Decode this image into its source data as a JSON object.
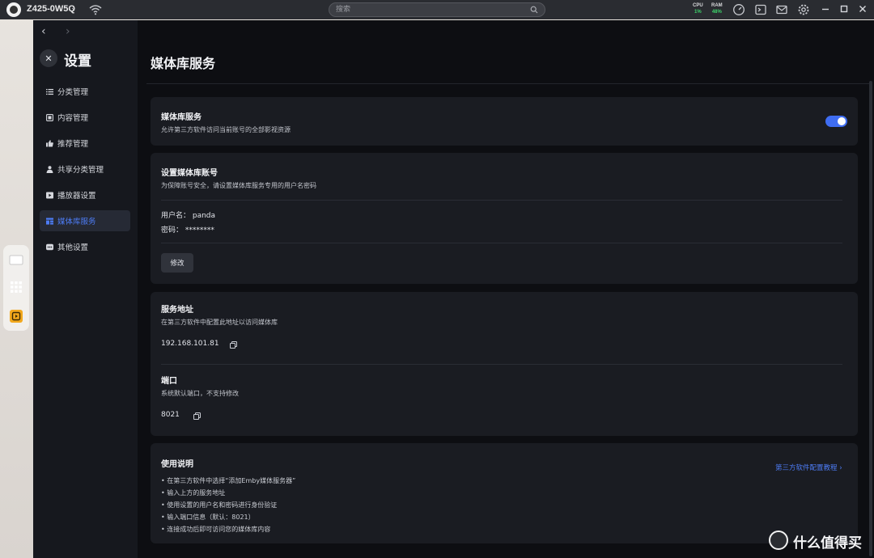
{
  "topbar": {
    "device_name": "Z425-0W5Q",
    "search_placeholder": "搜索",
    "cpu_label": "CPU",
    "cpu_value": "1%",
    "ram_label": "RAM",
    "ram_value": "48%"
  },
  "sidebar": {
    "title": "设置",
    "items": [
      {
        "label": "分类管理",
        "icon": "list-icon"
      },
      {
        "label": "内容管理",
        "icon": "content-icon"
      },
      {
        "label": "推荐管理",
        "icon": "thumb-up-icon"
      },
      {
        "label": "共享分类管理",
        "icon": "share-icon"
      },
      {
        "label": "播放器设置",
        "icon": "play-icon"
      },
      {
        "label": "媒体库服务",
        "icon": "media-library-icon",
        "active": true
      },
      {
        "label": "其他设置",
        "icon": "more-icon"
      }
    ]
  },
  "main": {
    "title": "媒体库服务",
    "service_card": {
      "title": "媒体库服务",
      "subtitle": "允许第三方软件访问当前账号的全部影视资源",
      "enabled": true
    },
    "account_card": {
      "title": "设置媒体库账号",
      "subtitle": "为保障账号安全，请设置媒体库服务专用的用户名密码",
      "username_line": "用户名：  panda",
      "password_line": "密码：  ********",
      "edit_label": "修改"
    },
    "address_card": {
      "address_title": "服务地址",
      "address_sub": "在第三方软件中配置此地址以访问媒体库",
      "address_value": "192.168.101.81",
      "port_title": "端口",
      "port_sub": "系统默认端口，不支持修改",
      "port_value": "8021"
    },
    "guide_card": {
      "title": "使用说明",
      "link": "第三方软件配置教程",
      "steps": [
        "在第三方软件中选择“添加Emby媒体服务器”",
        "输入上方的服务地址",
        "使用设置的用户名和密码进行身份验证",
        "输入端口信息（默认：8021）",
        "连接成功后即可访问您的媒体库内容"
      ]
    }
  },
  "watermark": "什么值得买",
  "colors": {
    "accent": "#4d7cf5",
    "toggle_on": "#3f6df2",
    "cpu_ram_value": "#3ed46b",
    "card_bg": "#1a1c22"
  }
}
